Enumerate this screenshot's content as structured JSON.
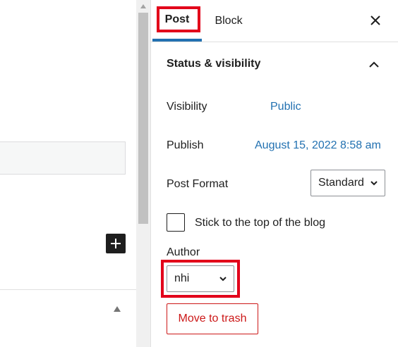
{
  "sidebar": {
    "tabs": [
      {
        "label": "Post",
        "active": true
      },
      {
        "label": "Block",
        "active": false
      }
    ],
    "close_icon": "close-icon",
    "panel": {
      "title": "Status & visibility",
      "expanded": true,
      "visibility_label": "Visibility",
      "visibility_value": "Public",
      "publish_label": "Publish",
      "publish_value": "August 15, 2022 8:58 am",
      "format_label": "Post Format",
      "format_value": "Standard",
      "sticky_label": "Stick to the top of the blog",
      "sticky_checked": false,
      "author_label": "Author",
      "author_value": "nhi",
      "trash_label": "Move to trash"
    }
  },
  "editor": {
    "inserter_icon": "plus-icon",
    "collapse_icon": "caret-up-icon"
  },
  "colors": {
    "accent": "#2271b1",
    "highlight": "#e2001a",
    "danger": "#cc1818"
  }
}
